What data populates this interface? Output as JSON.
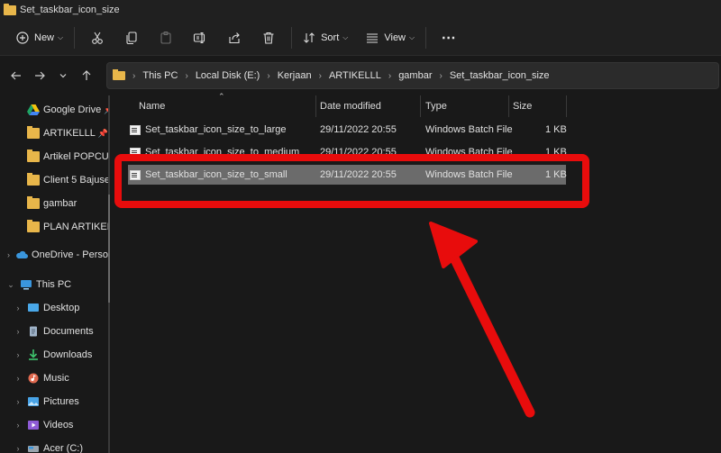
{
  "window": {
    "title": "Set_taskbar_icon_size"
  },
  "toolbar": {
    "new_label": "New",
    "sort_label": "Sort",
    "view_label": "View",
    "more_label": "⋯"
  },
  "nav": {
    "breadcrumbs": [
      "This PC",
      "Local Disk (E:)",
      "Kerjaan",
      "ARTIKELLL",
      "gambar",
      "Set_taskbar_icon_size"
    ]
  },
  "sidebar": {
    "items": [
      {
        "label": "Google Drive",
        "pinned": true,
        "icon": "google-drive-icon"
      },
      {
        "label": "ARTIKELLL",
        "pinned": true,
        "icon": "folder-icon"
      },
      {
        "label": "Artikel POPCUL",
        "pinned": false,
        "icon": "folder-icon"
      },
      {
        "label": "Client 5 Bajusel",
        "pinned": false,
        "icon": "folder-icon"
      },
      {
        "label": "gambar",
        "pinned": false,
        "icon": "folder-icon"
      },
      {
        "label": "PLAN ARTIKEL I",
        "pinned": false,
        "icon": "folder-icon"
      },
      {
        "label": "OneDrive - Perso",
        "icon": "cloud-icon"
      },
      {
        "label": "This PC",
        "icon": "pc-icon"
      },
      {
        "label": "Desktop",
        "icon": "desktop-icon"
      },
      {
        "label": "Documents",
        "icon": "documents-icon"
      },
      {
        "label": "Downloads",
        "icon": "downloads-icon"
      },
      {
        "label": "Music",
        "icon": "music-icon"
      },
      {
        "label": "Pictures",
        "icon": "pictures-icon"
      },
      {
        "label": "Videos",
        "icon": "videos-icon"
      },
      {
        "label": "Acer (C:)",
        "icon": "drive-icon"
      }
    ]
  },
  "columns": {
    "name": "Name",
    "date": "Date modified",
    "type": "Type",
    "size": "Size"
  },
  "files": [
    {
      "name": "Set_taskbar_icon_size_to_large",
      "date": "29/11/2022 20:55",
      "type": "Windows Batch File",
      "size": "1 KB",
      "selected": false
    },
    {
      "name": "Set_taskbar_icon_size_to_medium",
      "date": "29/11/2022 20:55",
      "type": "Windows Batch File",
      "size": "1 KB",
      "selected": false
    },
    {
      "name": "Set_taskbar_icon_size_to_small",
      "date": "29/11/2022 20:55",
      "type": "Windows Batch File",
      "size": "1 KB",
      "selected": true
    }
  ],
  "colors": {
    "annotation": "#e80c0c",
    "selection": "#6b6b6b",
    "folder": "#e8b64a"
  }
}
